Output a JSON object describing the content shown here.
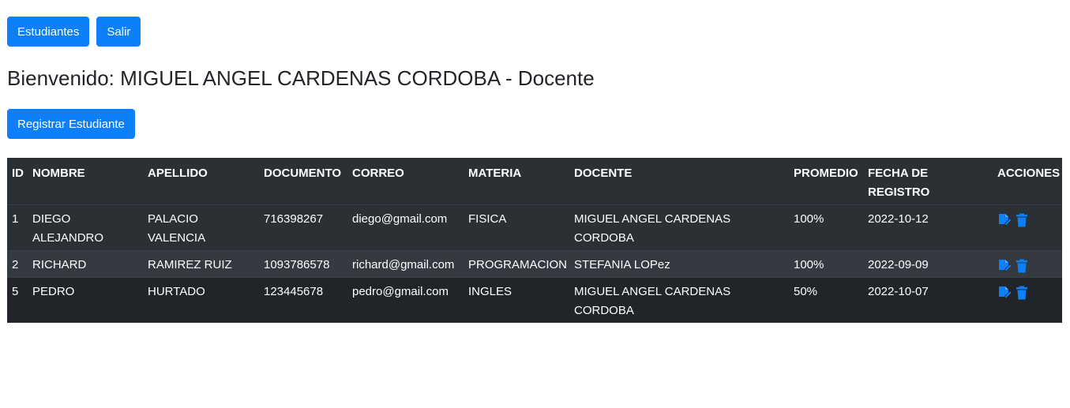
{
  "nav": {
    "students_label": "Estudiantes",
    "logout_label": "Salir"
  },
  "welcome": "Bienvenido: MIGUEL ANGEL CARDENAS CORDOBA - Docente",
  "register_label": "Registrar Estudiante",
  "colors": {
    "primary": "#0d7ff9",
    "table_dark": "#212529",
    "table_header": "#2b3035"
  },
  "table": {
    "headers": [
      "ID",
      "NOMBRE",
      "APELLIDO",
      "DOCUMENTO",
      "CORREO",
      "MATERIA",
      "DOCENTE",
      "PROMEDIO",
      "FECHA DE REGISTRO",
      "ACCIONES"
    ],
    "rows": [
      {
        "id": "1",
        "nombre": "DIEGO ALEJANDRO",
        "apellido": "PALACIO VALENCIA",
        "documento": "716398267",
        "correo": "diego@gmail.com",
        "materia": "FISICA",
        "docente": "MIGUEL ANGEL CARDENAS CORDOBA",
        "promedio": "100%",
        "fecha": "2022-10-12"
      },
      {
        "id": "2",
        "nombre": "RICHARD",
        "apellido": "RAMIREZ RUIZ",
        "documento": "1093786578",
        "correo": "richard@gmail.com",
        "materia": "PROGRAMACION",
        "docente": "STEFANIA LOPez",
        "promedio": "100%",
        "fecha": "2022-09-09"
      },
      {
        "id": "5",
        "nombre": "PEDRO",
        "apellido": "HURTADO",
        "documento": "123445678",
        "correo": "pedro@gmail.com",
        "materia": "INGLES",
        "docente": "MIGUEL ANGEL CARDENAS CORDOBA",
        "promedio": "50%",
        "fecha": "2022-10-07"
      }
    ],
    "action_icons": [
      "edit-icon",
      "trash-icon"
    ]
  }
}
